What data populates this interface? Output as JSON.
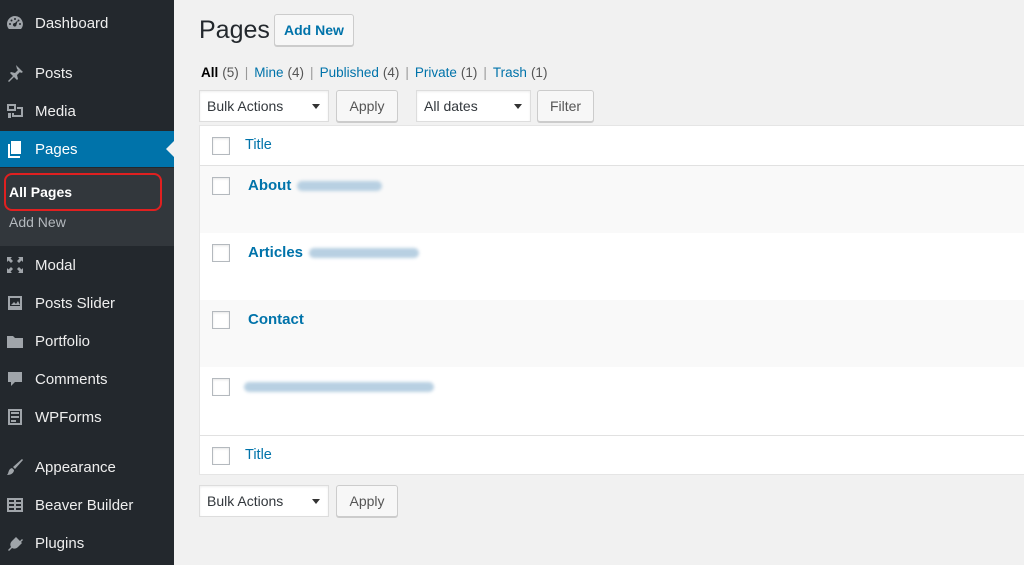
{
  "sidebar": {
    "items": [
      {
        "label": "Dashboard",
        "icon": "dashboard-icon"
      },
      {
        "label": "Posts",
        "icon": "pushpin-icon"
      },
      {
        "label": "Media",
        "icon": "media-icon"
      },
      {
        "label": "Pages",
        "icon": "pages-icon"
      },
      {
        "label": "Modal",
        "icon": "move-arrows-icon"
      },
      {
        "label": "Posts Slider",
        "icon": "slides-icon"
      },
      {
        "label": "Portfolio",
        "icon": "folder-icon"
      },
      {
        "label": "Comments",
        "icon": "comment-icon"
      },
      {
        "label": "WPForms",
        "icon": "forms-icon"
      },
      {
        "label": "Appearance",
        "icon": "brush-icon"
      },
      {
        "label": "Beaver Builder",
        "icon": "grid-icon"
      },
      {
        "label": "Plugins",
        "icon": "plugin-icon"
      }
    ],
    "submenu": [
      "All Pages",
      "Add New"
    ],
    "current_item": "Pages",
    "current_sub": "All Pages"
  },
  "header": {
    "title": "Pages",
    "add_new": "Add New"
  },
  "filters": {
    "views": [
      {
        "label": "All",
        "count": "(5)"
      },
      {
        "label": "Mine",
        "count": "(4)"
      },
      {
        "label": "Published",
        "count": "(4)"
      },
      {
        "label": "Private",
        "count": "(1)"
      },
      {
        "label": "Trash",
        "count": "(1)"
      }
    ],
    "bulk_actions": "Bulk Actions",
    "apply": "Apply",
    "dates": "All dates",
    "filter": "Filter"
  },
  "table": {
    "column_title": "Title",
    "rows": [
      {
        "title": "About"
      },
      {
        "title": "Articles"
      },
      {
        "title": "Contact"
      },
      {
        "title": ""
      }
    ]
  },
  "colors": {
    "sidebar_bg": "#23282d",
    "accent": "#0073aa",
    "highlight": "#e02020"
  }
}
